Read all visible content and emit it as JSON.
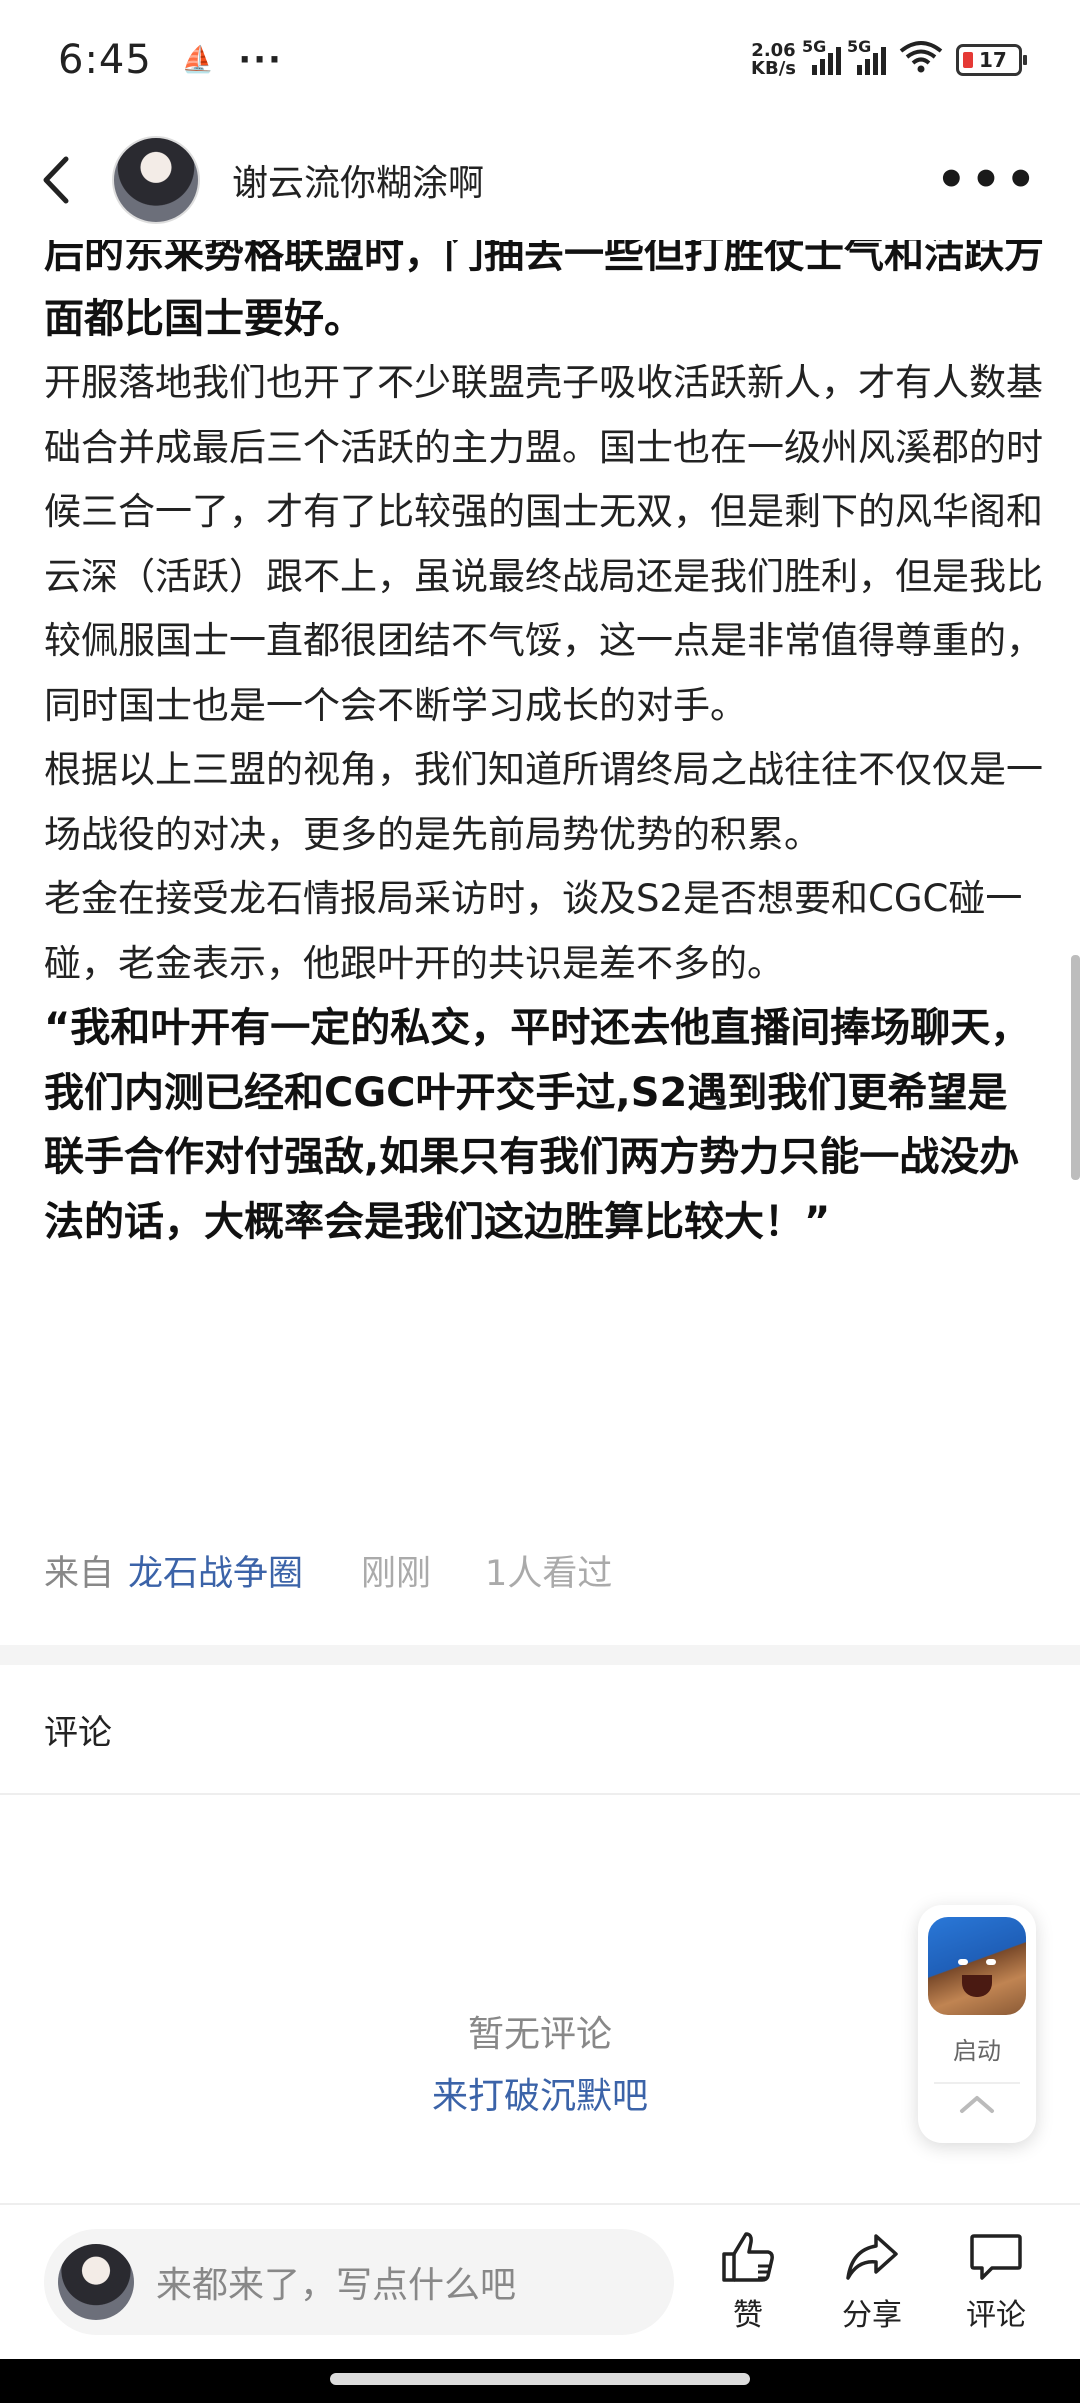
{
  "status_bar": {
    "time": "6:45",
    "dots": "···",
    "net_speed_value": "2.06",
    "net_speed_unit": "KB/s",
    "signal1": "5G",
    "signal2": "5G",
    "wifi_sub": "6",
    "battery": "17"
  },
  "header": {
    "author": "谢云流你糊涂啊"
  },
  "article": {
    "paragraphs": [
      {
        "bold": true,
        "text": "后的东来势格联盟时，门抽丢一些但打胜仗士气和活跃方面都比国士要好。"
      },
      {
        "bold": false,
        "text": "开服落地我们也开了不少联盟壳子吸收活跃新人，才有人数基础合并成最后三个活跃的主力盟。国士也在一级州风溪郡的时候三合一了，才有了比较强的国士无双，但是剩下的风华阁和云深（活跃）跟不上，虽说最终战局还是我们胜利，但是我比较佩服国士一直都很团结不气馁，这一点是非常值得尊重的，同时国士也是一个会不断学习成长的对手。"
      },
      {
        "bold": false,
        "text": "根据以上三盟的视角，我们知道所谓终局之战往往不仅仅是一场战役的对决，更多的是先前局势优势的积累。"
      },
      {
        "bold": false,
        "text": "老金在接受龙石情报局采访时，谈及S2是否想要和CGC碰一碰，老金表示，他跟叶开的共识是差不多的。"
      },
      {
        "bold": true,
        "text": "“我和叶开有一定的私交，平时还去他直播间捧场聊天，我们内测已经和CGC叶开交手过,S2遇到我们更希望是联手合作对付强敌,如果只有我们两方势力只能一战没办法的话，大概率会是我们这边胜算比较大！”"
      }
    ]
  },
  "meta": {
    "from_label": "来自",
    "circle_name": "龙石战争圈",
    "time": "刚刚",
    "views": "1人看过"
  },
  "comments": {
    "title": "评论",
    "empty_title": "暂无评论",
    "empty_action": "来打破沉默吧"
  },
  "float_card": {
    "launch_label": "启动"
  },
  "bottom_bar": {
    "input_placeholder": "来都来了，写点什么吧",
    "like_label": "赞",
    "share_label": "分享",
    "comment_label": "评论"
  }
}
